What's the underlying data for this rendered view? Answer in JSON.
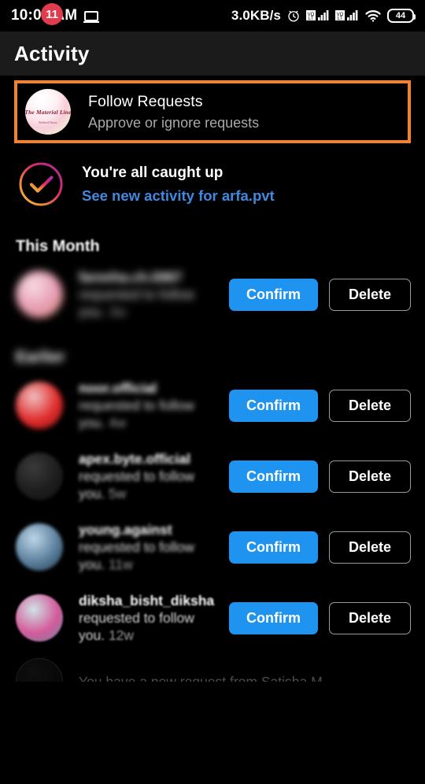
{
  "statusbar": {
    "time": "10:02 AM",
    "cast_icon": "screencast-icon",
    "net_speed": "3.0KB/s",
    "alarm_icon": "alarm-clock-icon",
    "sim1_icon": "sim1-signal-icon",
    "sim2_icon": "sim2-signal-icon",
    "wifi_icon": "wifi-icon",
    "battery_level": "44"
  },
  "header": {
    "title": "Activity"
  },
  "follow_requests": {
    "title": "Follow Requests",
    "subtitle": "Approve or ignore requests",
    "badge_count": "11",
    "avatar_brand_text": "The Material Line",
    "avatar_brand_sub": "Refined Decor",
    "highlight_color": "#f08233",
    "badge_color": "#e23b4e"
  },
  "caught_up": {
    "title": "You're all caught up",
    "link": "See new activity for arfa.pvt",
    "link_color": "#3f8ae0",
    "check_icon": "check-circle-gradient-icon"
  },
  "buttons": {
    "confirm": "Confirm",
    "delete": "Delete",
    "confirm_color": "#1f93f0"
  },
  "sections": [
    {
      "label": "This Month",
      "blur": "light",
      "requests": [
        {
          "username": "fareeha.ch.0987",
          "action": "requested to follow you.",
          "time": "3w",
          "avatar_colors": [
            "#f6dce4",
            "#e79ab0",
            "#c98a63"
          ],
          "blur": "heavy"
        }
      ]
    },
    {
      "label": "Earlier",
      "blur": "heavy",
      "requests": [
        {
          "username": "noor.official",
          "action": "requested to follow you.",
          "time": "4w",
          "avatar_colors": [
            "#f0c0c0",
            "#e02b2b",
            "#8a1414"
          ],
          "blur": "mid"
        },
        {
          "username": "apex.byte.official",
          "action": "requested to follow you.",
          "time": "5w",
          "avatar_colors": [
            "#3a3a3a",
            "#1d1d1d",
            "#111111"
          ],
          "blur": "soft"
        },
        {
          "username": "young.against",
          "action": "requested to follow you.",
          "time": "11w",
          "avatar_colors": [
            "#bcd6e8",
            "#5b7f9c",
            "#23394d"
          ],
          "blur": "soft"
        },
        {
          "username": "diksha_bisht_diksha",
          "action": "requested to follow you.",
          "time": "12w",
          "avatar_colors": [
            "#cfe3e6",
            "#d35b9a",
            "#6c88a8"
          ],
          "blur": "light"
        }
      ]
    }
  ],
  "partial_row": {
    "text": "You have a new request from Satisha M",
    "avatar_colors": [
      "#2a2a2a",
      "#1a1a1a",
      "#0d0d0d"
    ]
  }
}
